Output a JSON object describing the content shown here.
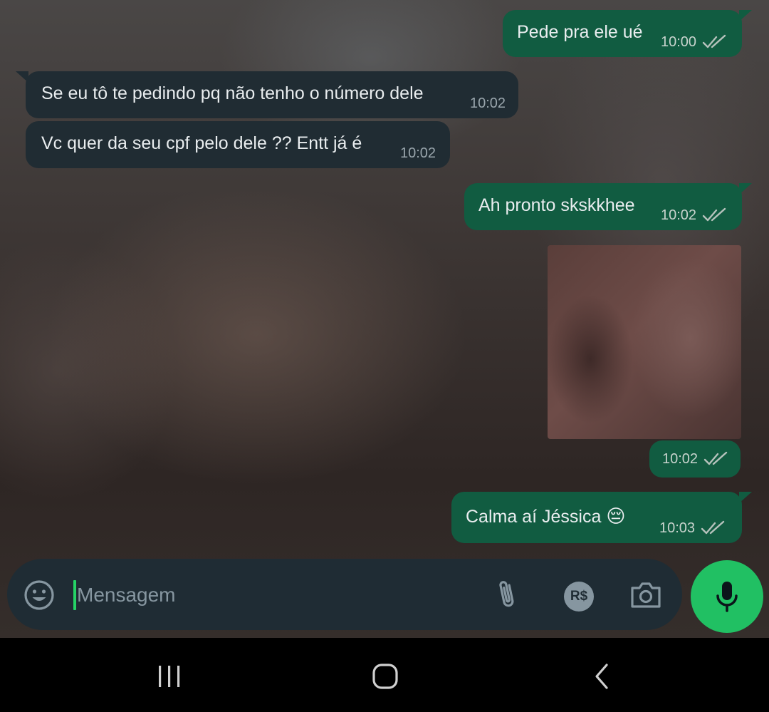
{
  "colors": {
    "outgoing_bubble": "#115c41",
    "incoming_bubble": "#202c33",
    "accent_green": "#21c063",
    "composer_bg": "#1f2c34",
    "nav_bar_bg": "#000000"
  },
  "messages": [
    {
      "direction": "outgoing",
      "text": "Pede pra ele ué",
      "time": "10:00",
      "status": "read"
    },
    {
      "direction": "incoming",
      "text": "Se eu tô te pedindo pq não tenho o número dele",
      "time": "10:02"
    },
    {
      "direction": "incoming",
      "text": "Vc quer da seu cpf pelo dele ?? Entt já é",
      "time": "10:02"
    },
    {
      "direction": "outgoing",
      "text": "Ah pronto skskkhee",
      "time": "10:02",
      "status": "read"
    },
    {
      "direction": "outgoing",
      "type": "image",
      "time": "10:02",
      "status": "read"
    },
    {
      "direction": "outgoing",
      "text": "Calma aí Jéssica",
      "emoji": "😔",
      "time": "10:03",
      "status": "read"
    }
  ],
  "composer": {
    "placeholder": "Mensagem",
    "payment_label": "R$",
    "icons": [
      "emoji-icon",
      "attach-icon",
      "payment-icon",
      "camera-icon",
      "mic-icon"
    ]
  },
  "nav_bar": {
    "icons": [
      "recents-icon",
      "home-icon",
      "back-icon"
    ]
  }
}
